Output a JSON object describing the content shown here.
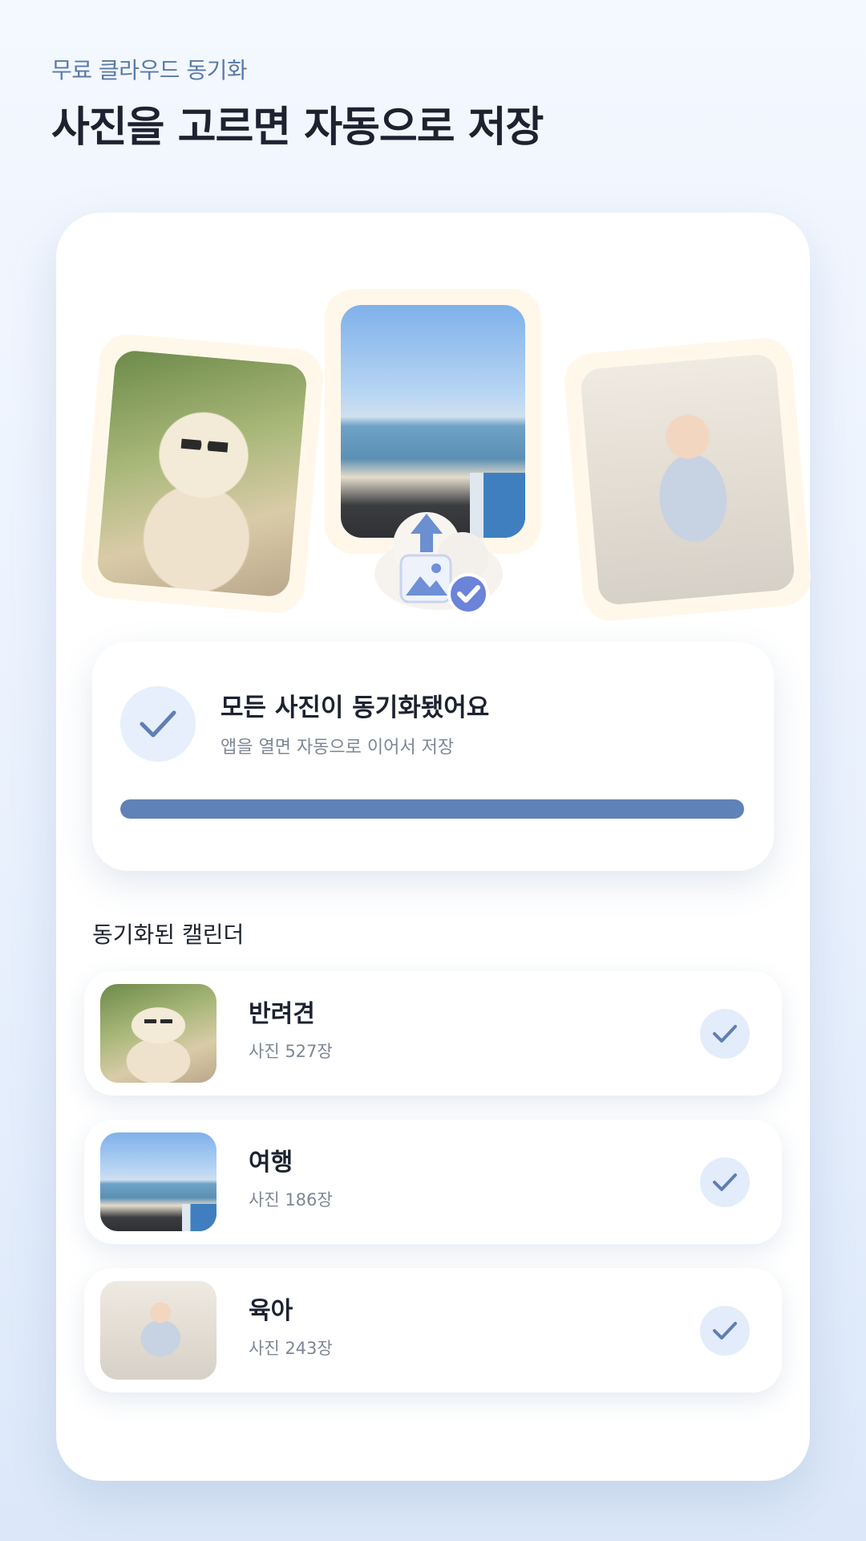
{
  "header": {
    "eyebrow": "무료 클라우드 동기화",
    "headline": "사진을 고르면 자동으로 저장"
  },
  "hero": {
    "photos": [
      {
        "subject": "dog-photo"
      },
      {
        "subject": "seaside-photo"
      },
      {
        "subject": "baby-photo"
      }
    ],
    "badge_icon": "cloud-upload-check-icon"
  },
  "status": {
    "title": "모든 사진이 동기화됐어요",
    "subtitle": "앱을 열면 자동으로 이어서 저장",
    "progress": 1.0,
    "icon": "check-icon"
  },
  "calendars": {
    "section_label": "동기화된 캘린더",
    "items": [
      {
        "title": "반려견",
        "count": "사진 527장",
        "thumb": "dog-photo"
      },
      {
        "title": "여행",
        "count": "사진 186장",
        "thumb": "seaside-photo"
      },
      {
        "title": "육아",
        "count": "사진 243장",
        "thumb": "baby-photo"
      }
    ]
  },
  "colors": {
    "accent": "#5f82b8",
    "check_bg": "#e6effb",
    "frame_bg": "#fff8ea"
  }
}
